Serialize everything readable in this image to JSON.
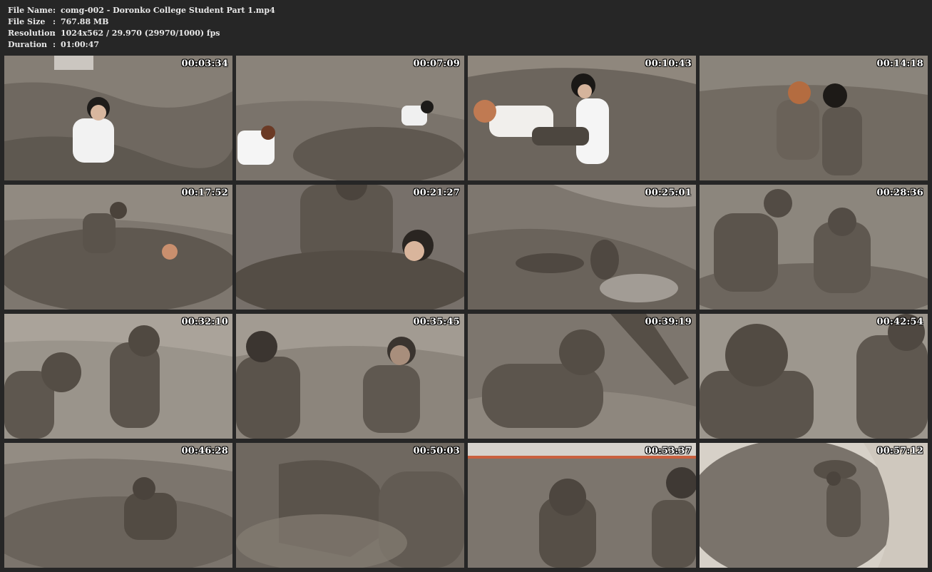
{
  "info": {
    "file_name_label": "File Name",
    "file_name_value": "comg-002 - Doronko College Student Part 1.mp4",
    "file_size_label": "File Size",
    "file_size_value": "767.88 MB",
    "resolution_label": "Resolution",
    "resolution_value": "1024x562 / 29.970 (29970/1000) fps",
    "duration_label": "Duration",
    "duration_value": "01:00:47",
    "separator": ":"
  },
  "thumbnails": [
    {
      "timestamp": "00:03:34"
    },
    {
      "timestamp": "00:07:09"
    },
    {
      "timestamp": "00:10:43"
    },
    {
      "timestamp": "00:14:18"
    },
    {
      "timestamp": "00:17:52"
    },
    {
      "timestamp": "00:21:27"
    },
    {
      "timestamp": "00:25:01"
    },
    {
      "timestamp": "00:28:36"
    },
    {
      "timestamp": "00:32:10"
    },
    {
      "timestamp": "00:35:45"
    },
    {
      "timestamp": "00:39:19"
    },
    {
      "timestamp": "00:42:54"
    },
    {
      "timestamp": "00:46:28"
    },
    {
      "timestamp": "00:50:03"
    },
    {
      "timestamp": "00:53:37"
    },
    {
      "timestamp": "00:57:12"
    }
  ],
  "colors": {
    "background": "#262626",
    "text": "#e9e9e9",
    "mud_dark": "#5b544c",
    "mud_mid": "#7a736b",
    "mud_light": "#a49d94"
  }
}
